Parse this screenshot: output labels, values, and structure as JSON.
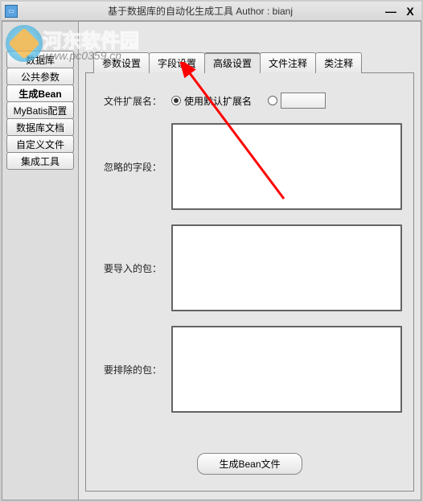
{
  "window": {
    "title": "基于数据库的自动化生成工具  Author : bianj",
    "minimize": "—",
    "close": "X"
  },
  "watermark": {
    "text": "河东软件园",
    "url": "www.pc0359.cn"
  },
  "sidebar": {
    "items": [
      {
        "label": "数据库",
        "active": false
      },
      {
        "label": "公共参数",
        "active": false
      },
      {
        "label": "生成Bean",
        "active": true
      },
      {
        "label": "MyBatis配置",
        "active": false
      },
      {
        "label": "数据库文档",
        "active": false
      },
      {
        "label": "自定义文件",
        "active": false
      },
      {
        "label": "集成工具",
        "active": false
      }
    ]
  },
  "tabs": [
    {
      "label": "参数设置",
      "active": false
    },
    {
      "label": "字段设置",
      "active": false
    },
    {
      "label": "高级设置",
      "active": true
    },
    {
      "label": "文件注释",
      "active": false
    },
    {
      "label": "类注释",
      "active": false
    }
  ],
  "form": {
    "extension_label": "文件扩展名：",
    "extension_radio_default": "使用默认扩展名",
    "custom_ext_value": "",
    "ignore_fields_label": "忽略的字段：",
    "ignore_fields_value": "",
    "import_packages_label": "要导入的包：",
    "import_packages_value": "",
    "exclude_packages_label": "要排除的包：",
    "exclude_packages_value": "",
    "generate_button": "生成Bean文件"
  }
}
